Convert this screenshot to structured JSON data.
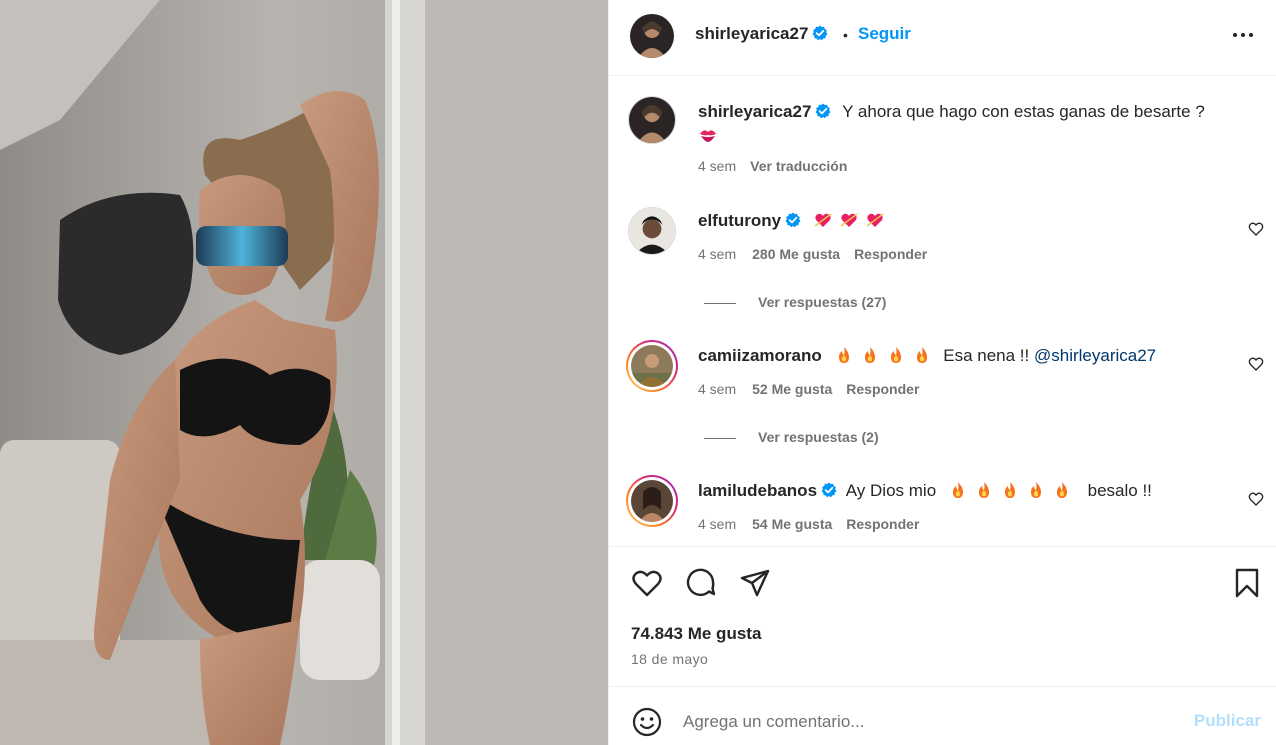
{
  "post": {
    "image_alt_icon": "photo",
    "author": {
      "username": "shirleyarica27",
      "verified": true,
      "dot": "•",
      "follow_label": "Seguir"
    },
    "caption": {
      "username": "shirleyarica27",
      "text": "Y ahora que hago con estas ganas de besarte ?",
      "emoji": "kiss-mark-emoji",
      "age": "4 sem",
      "translate_label": "Ver traducción"
    },
    "comments": [
      {
        "username": "elfuturony",
        "verified": true,
        "text": "",
        "emojis": [
          "heart-arrow-emoji",
          "heart-arrow-emoji",
          "heart-arrow-emoji"
        ],
        "age": "4 sem",
        "likes": "280 Me gusta",
        "reply_label": "Responder",
        "replies_label": "Ver respuestas (27)"
      },
      {
        "username": "camiizamorano",
        "verified": false,
        "text_after_emojis": "Esa nena !!",
        "mention": "@shirleyarica27",
        "emojis": [
          "fire-emoji",
          "fire-emoji",
          "fire-emoji",
          "fire-emoji"
        ],
        "age": "4 sem",
        "likes": "52 Me gusta",
        "reply_label": "Responder",
        "replies_label": "Ver respuestas (2)"
      },
      {
        "username": "lamiludebanos",
        "verified": true,
        "text_before_emojis": "Ay Dios mio",
        "text_after_emojis": "besalo !!",
        "emojis": [
          "fire-emoji",
          "fire-emoji",
          "fire-emoji",
          "fire-emoji",
          "fire-emoji"
        ],
        "age": "4 sem",
        "likes": "54 Me gusta",
        "reply_label": "Responder"
      }
    ],
    "stats": {
      "likes": "74.843 Me gusta",
      "date": "18 de mayo"
    },
    "composer": {
      "placeholder": "Agrega un comentario...",
      "publish_label": "Publicar"
    },
    "colors": {
      "accent": "#0095f6",
      "verified": "#0095f6",
      "muted": "#737373",
      "publish_disabled": "#b2dffc",
      "story_ring_start": "#feda75",
      "story_ring_end": "#d62976"
    }
  }
}
